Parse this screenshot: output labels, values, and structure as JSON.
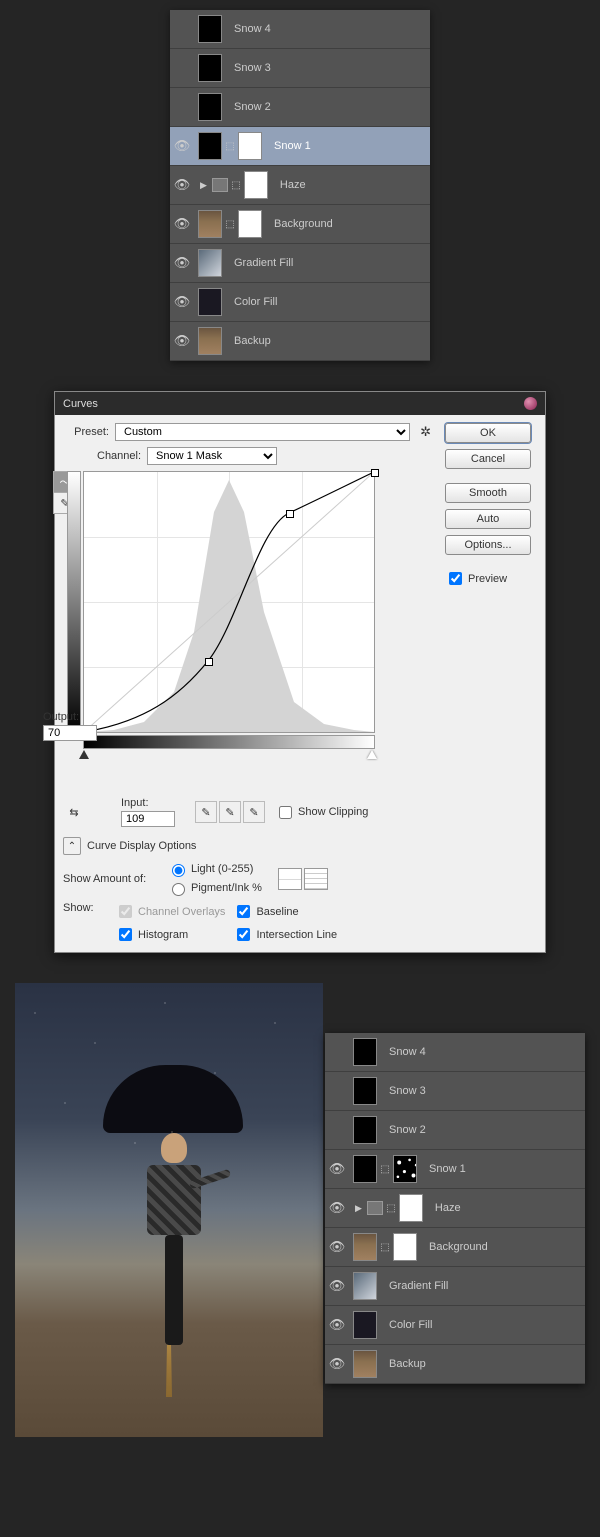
{
  "layers_top": [
    {
      "name": "Snow 4",
      "visible": false,
      "selected": false,
      "thumbs": [
        "black"
      ]
    },
    {
      "name": "Snow 3",
      "visible": false,
      "selected": false,
      "thumbs": [
        "black"
      ]
    },
    {
      "name": "Snow 2",
      "visible": false,
      "selected": false,
      "thumbs": [
        "black"
      ]
    },
    {
      "name": "Snow 1",
      "visible": true,
      "selected": true,
      "thumbs": [
        "black",
        "link",
        "white"
      ]
    },
    {
      "name": "Haze",
      "visible": true,
      "selected": false,
      "group": true,
      "thumbs": [
        "white"
      ]
    },
    {
      "name": "Background",
      "visible": true,
      "selected": false,
      "thumbs": [
        "photo",
        "link",
        "white"
      ]
    },
    {
      "name": "Gradient Fill",
      "visible": true,
      "selected": false,
      "thumbs": [
        "grad"
      ]
    },
    {
      "name": "Color Fill",
      "visible": true,
      "selected": false,
      "thumbs": [
        "dark"
      ]
    },
    {
      "name": "Backup",
      "visible": true,
      "selected": false,
      "thumbs": [
        "photo"
      ]
    }
  ],
  "layers_bottom": [
    {
      "name": "Snow 4",
      "visible": false,
      "thumbs": [
        "black"
      ]
    },
    {
      "name": "Snow 3",
      "visible": false,
      "thumbs": [
        "black"
      ]
    },
    {
      "name": "Snow 2",
      "visible": false,
      "thumbs": [
        "black"
      ]
    },
    {
      "name": "Snow 1",
      "visible": true,
      "thumbs": [
        "black",
        "link",
        "speck"
      ]
    },
    {
      "name": "Haze",
      "visible": true,
      "group": true,
      "thumbs": [
        "white"
      ]
    },
    {
      "name": "Background",
      "visible": true,
      "thumbs": [
        "photo",
        "link",
        "white"
      ]
    },
    {
      "name": "Gradient Fill",
      "visible": true,
      "thumbs": [
        "grad"
      ]
    },
    {
      "name": "Color Fill",
      "visible": true,
      "thumbs": [
        "dark"
      ]
    },
    {
      "name": "Backup",
      "visible": true,
      "thumbs": [
        "photo"
      ]
    }
  ],
  "curves": {
    "title": "Curves",
    "preset_label": "Preset:",
    "preset_value": "Custom",
    "channel_label": "Channel:",
    "channel_value": "Snow 1 Mask",
    "output_label": "Output:",
    "output_value": "70",
    "input_label": "Input:",
    "input_value": "109",
    "show_clipping": "Show Clipping",
    "display_options": "Curve Display Options",
    "show_amount": "Show Amount of:",
    "radio_light": "Light  (0-255)",
    "radio_pigment": "Pigment/Ink %",
    "show_label": "Show:",
    "chk_overlays": "Channel Overlays",
    "chk_baseline": "Baseline",
    "chk_histogram": "Histogram",
    "chk_intersection": "Intersection Line",
    "btn_ok": "OK",
    "btn_cancel": "Cancel",
    "btn_smooth": "Smooth",
    "btn_auto": "Auto",
    "btn_options": "Options...",
    "chk_preview": "Preview"
  },
  "chart_data": {
    "type": "line",
    "title": "Curves",
    "xlabel": "Input",
    "ylabel": "Output",
    "xlim": [
      0,
      255
    ],
    "ylim": [
      0,
      255
    ],
    "points": [
      {
        "x": 0,
        "y": 0
      },
      {
        "x": 109,
        "y": 70
      },
      {
        "x": 180,
        "y": 215
      },
      {
        "x": 255,
        "y": 255
      }
    ],
    "histogram_peak_x": 128
  }
}
